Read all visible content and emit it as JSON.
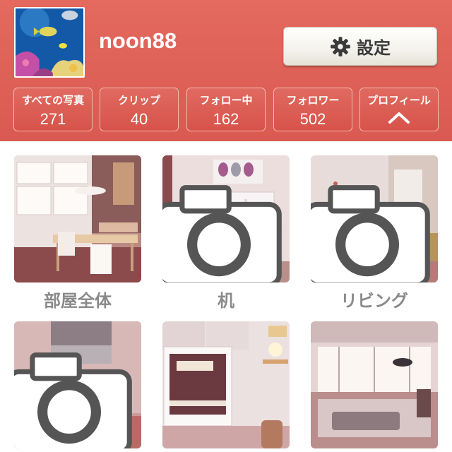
{
  "profile": {
    "username": "noon88",
    "avatar_desc": "aquarium-fish-photo"
  },
  "settings": {
    "label": "設定",
    "icon": "gear-icon"
  },
  "stats": [
    {
      "label": "すべての写真",
      "count": "271"
    },
    {
      "label": "クリップ",
      "count": "40"
    },
    {
      "label": "フォロー中",
      "count": "162"
    },
    {
      "label": "フォロワー",
      "count": "502"
    },
    {
      "label": "プロフィール",
      "icon": "chevron-up-icon"
    }
  ],
  "albums": [
    {
      "label": "部屋全体",
      "has_camera_badge": false
    },
    {
      "label": "机",
      "has_camera_badge": true
    },
    {
      "label": "リビング",
      "has_camera_badge": true
    },
    {
      "label": "",
      "has_camera_badge": true
    },
    {
      "label": "",
      "has_camera_badge": false
    },
    {
      "label": "",
      "has_camera_badge": false
    }
  ],
  "colors": {
    "header_bg": "#d95a50",
    "stat_border": "#f2b9b3",
    "label_gray": "#8a8a8a",
    "settings_bg": "#f3f2ec"
  }
}
